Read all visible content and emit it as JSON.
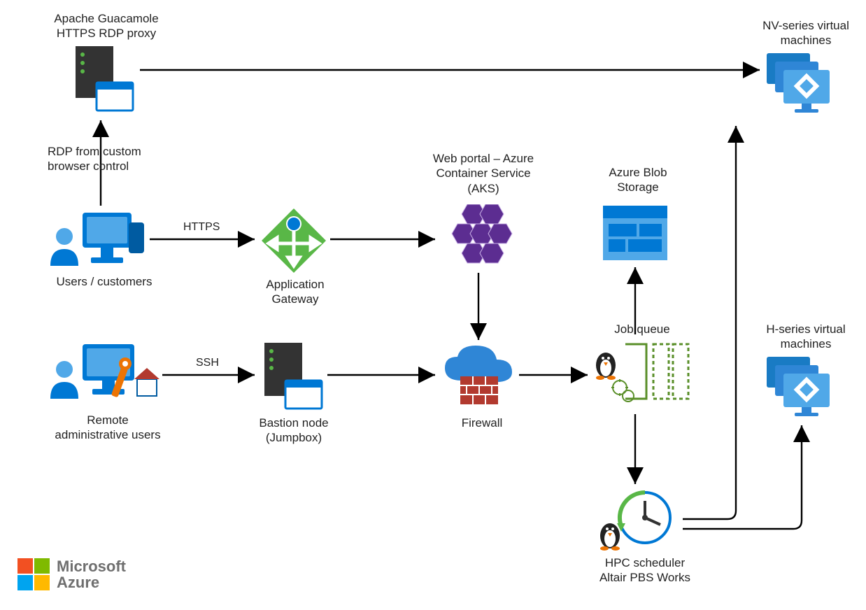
{
  "nodes": {
    "guacamole": "Apache Guacamole\nHTTPS RDP proxy",
    "rdp_edge": "RDP from custom\nbrowser control",
    "users": "Users / customers",
    "appgw": "Application\nGateway",
    "aks": "Web portal – Azure\nContainer Service\n(AKS)",
    "remote_admins": "Remote\nadministrative users",
    "bastion": "Bastion node\n(Jumpbox)",
    "firewall": "Firewall",
    "blob": "Azure Blob\nStorage",
    "jobqueue": "Job queue",
    "scheduler": "HPC scheduler\nAltair PBS Works",
    "nv_vms": "NV-series virtual\nmachines",
    "h_vms": "H-series virtual\nmachines"
  },
  "edges": {
    "https": "HTTPS",
    "ssh": "SSH"
  },
  "branding": {
    "line1": "Microsoft",
    "line2": "Azure"
  },
  "colors": {
    "arrow": "#000000",
    "azure_blue": "#0078d4",
    "azure_blue_light": "#50a8e8",
    "green": "#59b747",
    "purple": "#5c2d91",
    "orange": "#ec7404",
    "dark": "#333333",
    "olive": "#5a8f29",
    "brick": "#b23a2f"
  }
}
